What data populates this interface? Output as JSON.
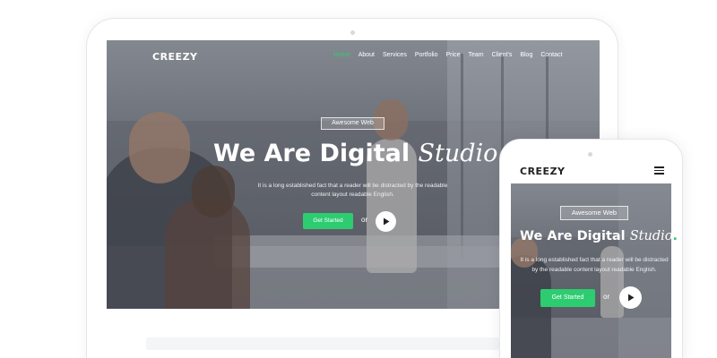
{
  "site": {
    "logo": "CREEZY",
    "nav": {
      "items": [
        "Home",
        "About",
        "Services",
        "Portfolio",
        "Price",
        "Team",
        "Client's",
        "Blog",
        "Contact"
      ],
      "active": "Home"
    }
  },
  "hero": {
    "badge": "Awesome Web",
    "headline_plain": "We Are Digital",
    "headline_italic": "Studio",
    "headline_dot": ".",
    "subtitle_line1": "It is a long established fact that a reader will be distracted by the readable",
    "subtitle_line2": "content layout readable English.",
    "cta_label": "Get Started",
    "or_text": "or",
    "play_icon": "play-icon"
  },
  "phone": {
    "subtitle_line1": "It is a long established fact that a reader will be distracted",
    "subtitle_line2": "by the readable content layout readable English.",
    "menu_icon": "hamburger-menu-icon"
  },
  "colors": {
    "accent": "#2ecc71",
    "text_on_hero": "#ffffff",
    "logo_on_light": "#222222",
    "device_frame": "#e4e6ea"
  }
}
